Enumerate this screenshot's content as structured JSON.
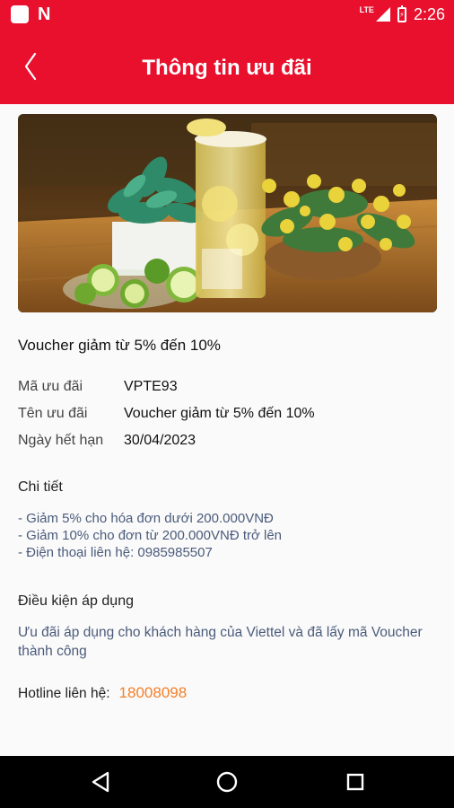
{
  "status_bar": {
    "network": "LTE",
    "time": "2:26",
    "app_badge": "N"
  },
  "app_bar": {
    "title": "Thông tin ưu đãi"
  },
  "voucher": {
    "title": "Voucher giảm từ 5% đến 10%",
    "code_label": "Mã ưu đãi",
    "code_value": "VPTE93",
    "name_label": "Tên ưu đãi",
    "name_value": "Voucher giảm từ 5% đến 10%",
    "expiry_label": "Ngày hết hạn",
    "expiry_value": "30/04/2023"
  },
  "details": {
    "heading": "Chi tiết",
    "lines": [
      "- Giảm 5% cho hóa đơn dưới 200.000VNĐ",
      "- Giảm 10% cho đơn từ 200.000VNĐ trở lên",
      "- Điện thoại liên hệ: 0985985507"
    ]
  },
  "conditions": {
    "heading": "Điều kiện áp dụng",
    "text": "Ưu đãi áp dụng cho khách hàng của Viettel và đã lấy mã Voucher thành công"
  },
  "hotline": {
    "label": "Hotline liên hệ:",
    "number": "18008098"
  },
  "colors": {
    "brand_red": "#e8102d",
    "hotline_orange": "#f4802a",
    "detail_text": "#4b5b7b"
  }
}
